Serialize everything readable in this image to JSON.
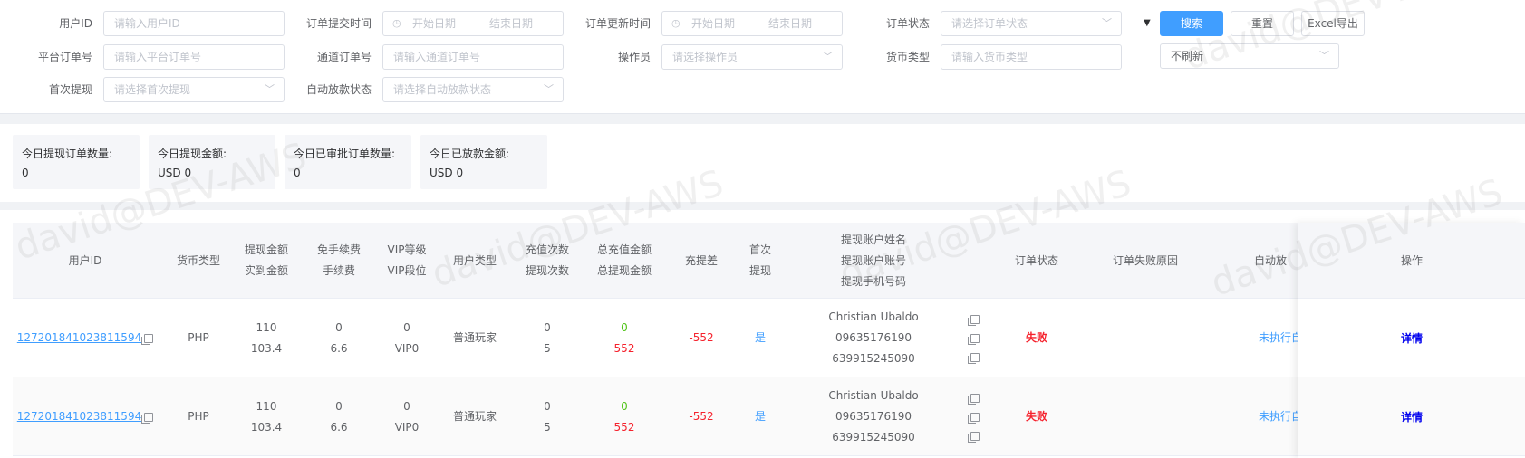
{
  "filters": {
    "user_id": {
      "label": "用户ID",
      "placeholder": "请输入用户ID"
    },
    "submit_time": {
      "label": "订单提交时间",
      "start": "开始日期",
      "sep": "-",
      "end": "结束日期"
    },
    "update_time": {
      "label": "订单更新时间",
      "start": "开始日期",
      "sep": "-",
      "end": "结束日期"
    },
    "order_status": {
      "label": "订单状态",
      "placeholder": "请选择订单状态"
    },
    "platform_order": {
      "label": "平台订单号",
      "placeholder": "请输入平台订单号"
    },
    "channel_order": {
      "label": "通道订单号",
      "placeholder": "请输入通道订单号"
    },
    "operator": {
      "label": "操作员",
      "placeholder": "请选择操作员"
    },
    "currency": {
      "label": "货币类型",
      "placeholder": "请输入货币类型"
    },
    "first_withdraw": {
      "label": "首次提现",
      "placeholder": "请选择首次提现"
    },
    "auto_release": {
      "label": "自动放款状态",
      "placeholder": "请选择自动放款状态"
    }
  },
  "actions": {
    "search": "搜索",
    "reset": "重置",
    "export": "Excel导出",
    "refresh_value": "不刷新"
  },
  "stats": [
    {
      "label": "今日提现订单数量:",
      "value": "0"
    },
    {
      "label": "今日提现金额:",
      "value": "USD 0"
    },
    {
      "label": "今日已审批订单数量:",
      "value": "0"
    },
    {
      "label": "今日已放款金额:",
      "value": "USD 0"
    }
  ],
  "table": {
    "headers": {
      "user_id": "用户ID",
      "currency": "货币类型",
      "amount": [
        "提现金额",
        "实到金额"
      ],
      "fee": [
        "免手续费",
        "手续费"
      ],
      "vip": [
        "VIP等级",
        "VIP段位"
      ],
      "user_type": "用户类型",
      "counts": [
        "充值次数",
        "提现次数"
      ],
      "totals": [
        "总充值金额",
        "总提现金额"
      ],
      "diff": "充提差",
      "first": [
        "首次",
        "提现"
      ],
      "account": [
        "提现账户姓名",
        "提现账户账号",
        "提现手机号码"
      ],
      "status": "订单状态",
      "fail_reason": "订单失败原因",
      "auto": "自动放",
      "ops": "操作"
    },
    "rows": [
      {
        "user_id": "127201841023811594",
        "currency": "PHP",
        "amount": "110",
        "received": "103.4",
        "free_fee": "0",
        "fee": "6.6",
        "vip_level": "0",
        "vip_rank": "VIP0",
        "user_type": "普通玩家",
        "recharge_count": "0",
        "withdraw_count": "5",
        "total_recharge": "0",
        "total_withdraw": "552",
        "diff": "-552",
        "first": "是",
        "acc_name": "Christian Ubaldo",
        "acc_no": "09635176190",
        "acc_phone": "639915245090",
        "status": "失败",
        "fail_reason": "",
        "auto": "未执行自",
        "ops": "详情"
      },
      {
        "user_id": "127201841023811594",
        "currency": "PHP",
        "amount": "110",
        "received": "103.4",
        "free_fee": "0",
        "fee": "6.6",
        "vip_level": "0",
        "vip_rank": "VIP0",
        "user_type": "普通玩家",
        "recharge_count": "0",
        "withdraw_count": "5",
        "total_recharge": "0",
        "total_withdraw": "552",
        "diff": "-552",
        "first": "是",
        "acc_name": "Christian Ubaldo",
        "acc_no": "09635176190",
        "acc_phone": "639915245090",
        "status": "失败",
        "fail_reason": "",
        "auto": "未执行自",
        "ops": "详情"
      }
    ]
  },
  "watermark": "david@DEV-AWS",
  "colors": {
    "primary": "#409eff",
    "danger": "#f5222d",
    "success": "#52c41a"
  }
}
